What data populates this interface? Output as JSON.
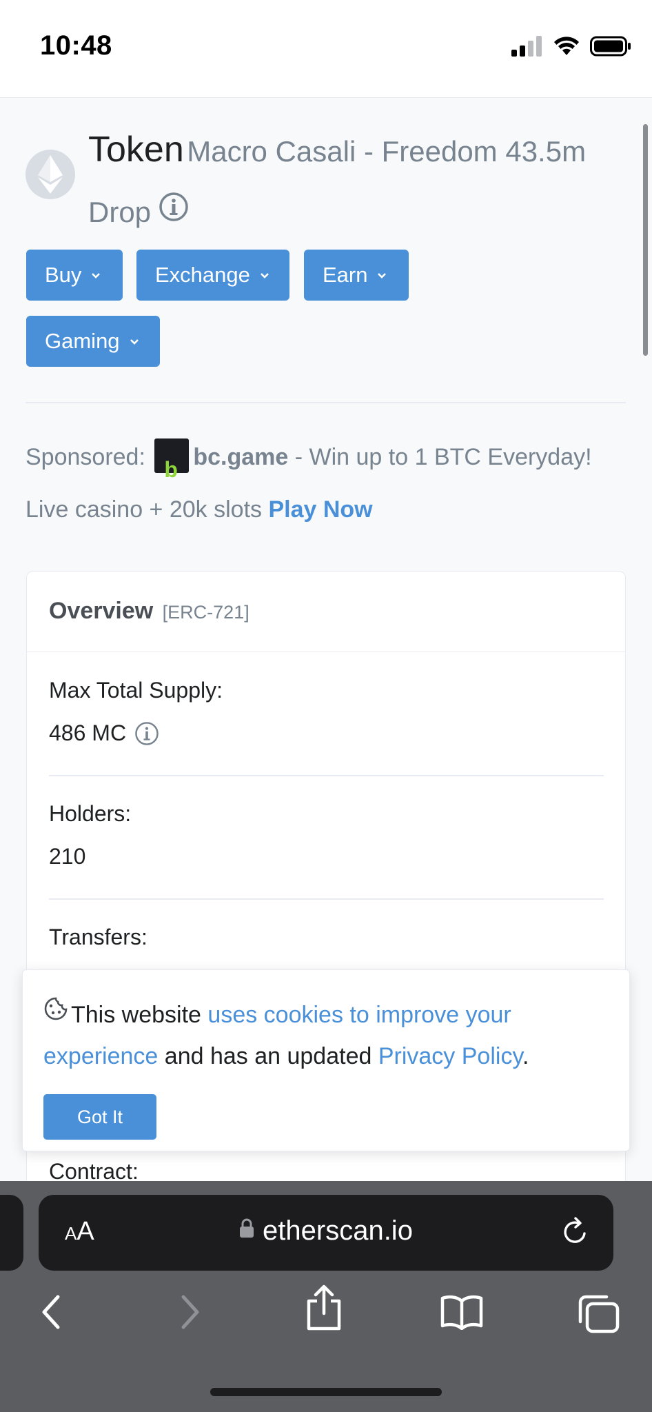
{
  "status_bar": {
    "time": "10:48"
  },
  "header": {
    "token_label": "Token",
    "token_name": "Macro Casali - Freedom 43.5m Drop"
  },
  "actions": [
    {
      "label": "Buy"
    },
    {
      "label": "Exchange"
    },
    {
      "label": "Earn"
    },
    {
      "label": "Gaming"
    }
  ],
  "sponsored": {
    "prefix": "Sponsored:",
    "logo_letter": "b",
    "brand": "bc.game",
    "text": " - Win up to 1 BTC Everyday! Live casino + 20k slots ",
    "cta": "Play Now"
  },
  "overview": {
    "title": "Overview",
    "standard": "[ERC-721]",
    "max_supply_label": "Max Total Supply:",
    "max_supply_value": "486 MC",
    "holders_label": "Holders:",
    "holders_value": "210",
    "transfers_label": "Transfers:",
    "contract_label": "Contract:"
  },
  "cookie_banner": {
    "text_start": "This website ",
    "link1": "uses cookies to improve your experience",
    "text_mid": " and has an updated ",
    "link2": "Privacy Policy",
    "text_end": ".",
    "button": "Got It"
  },
  "browser": {
    "aa_label": "A",
    "aa_label_big": "A",
    "url": "etherscan.io"
  },
  "colors": {
    "primary": "#4a90d9",
    "muted": "#77838f",
    "text": "#1e2022",
    "safari_toolbar": "#5c5d61"
  }
}
